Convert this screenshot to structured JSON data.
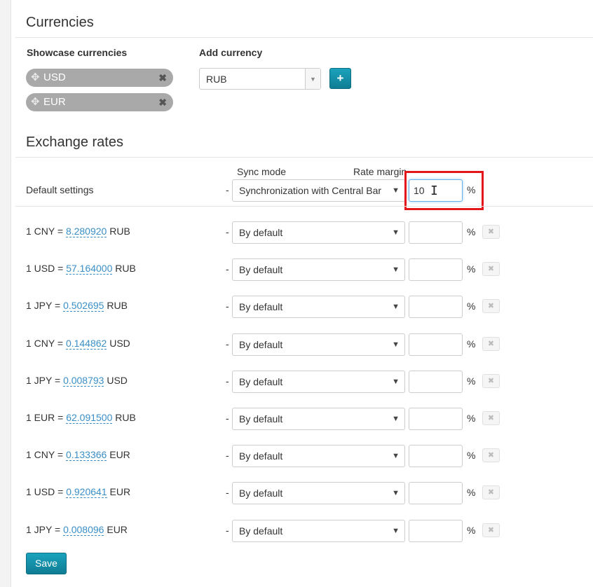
{
  "currencies": {
    "title": "Currencies",
    "showcase_label": "Showcase currencies",
    "add_label": "Add currency",
    "showcase": [
      {
        "code": "USD"
      },
      {
        "code": "EUR"
      }
    ],
    "add_select_value": "RUB",
    "add_button": "+"
  },
  "exchange": {
    "title": "Exchange rates",
    "sync_mode_header": "Sync mode",
    "rate_margin_header": "Rate margin",
    "default_label": "Default settings",
    "default_sync": "Synchronization with Central Bar",
    "default_margin": "10",
    "percent": "%",
    "dash": "-",
    "rates": [
      {
        "prefix": "1 CNY = ",
        "value": "8.280920",
        "suffix": " RUB",
        "sync": "By default",
        "margin": ""
      },
      {
        "prefix": "1 USD = ",
        "value": "57.164000",
        "suffix": " RUB",
        "sync": "By default",
        "margin": ""
      },
      {
        "prefix": "1 JPY = ",
        "value": "0.502695",
        "suffix": " RUB",
        "sync": "By default",
        "margin": ""
      },
      {
        "prefix": "1 CNY = ",
        "value": "0.144862",
        "suffix": " USD",
        "sync": "By default",
        "margin": ""
      },
      {
        "prefix": "1 JPY = ",
        "value": "0.008793",
        "suffix": " USD",
        "sync": "By default",
        "margin": ""
      },
      {
        "prefix": "1 EUR = ",
        "value": "62.091500",
        "suffix": " RUB",
        "sync": "By default",
        "margin": ""
      },
      {
        "prefix": "1 CNY = ",
        "value": "0.133366",
        "suffix": " EUR",
        "sync": "By default",
        "margin": ""
      },
      {
        "prefix": "1 USD = ",
        "value": "0.920641",
        "suffix": " EUR",
        "sync": "By default",
        "margin": ""
      },
      {
        "prefix": "1 JPY = ",
        "value": "0.008096",
        "suffix": " EUR",
        "sync": "By default",
        "margin": ""
      }
    ]
  },
  "save_label": "Save",
  "icons": {
    "move": "move-icon",
    "remove": "remove-icon",
    "dropdown": "chevron-down-icon",
    "text_cursor": "text-cursor-icon"
  },
  "colors": {
    "accent": "#1494ad",
    "link": "#3a8fc7",
    "highlight": "#e4161c"
  }
}
